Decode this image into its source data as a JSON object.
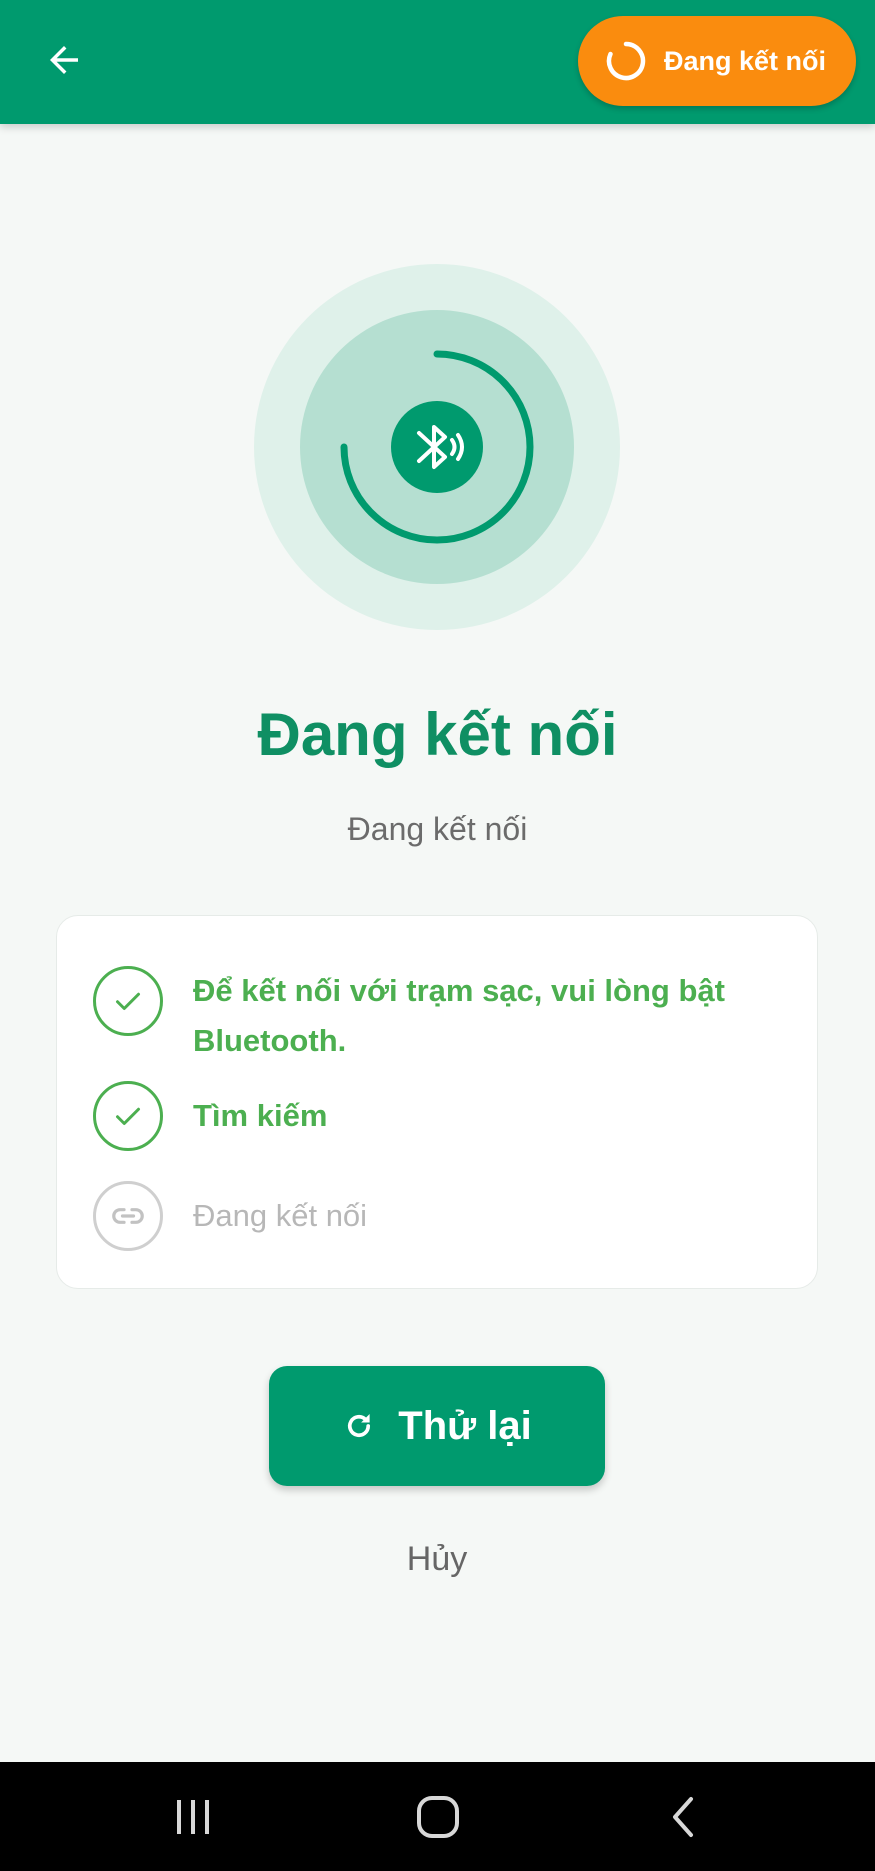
{
  "colors": {
    "primary": "#009a6e",
    "title_green": "#0f8f63",
    "success_green": "#4caf50",
    "status_orange": "#fa8c0e",
    "pending_gray": "#b7b7b7"
  },
  "header": {
    "back_icon": "arrow-left-icon",
    "status_badge": {
      "icon": "spinner-icon",
      "label": "Đang kết nối"
    }
  },
  "hero": {
    "icon": "bluetooth-searching-icon",
    "progress_fraction": 0.75
  },
  "main": {
    "title": "Đang kết nối",
    "subtitle": "Đang kết nối"
  },
  "steps": [
    {
      "label_line1": "Để kết nối với trạm sạc, vui lòng bật",
      "label_line2": "Bluetooth.",
      "state": "done",
      "icon": "check-icon"
    },
    {
      "label": "Tìm kiếm",
      "state": "done",
      "icon": "check-icon"
    },
    {
      "label": "Đang kết nối",
      "state": "pending",
      "icon": "link-icon"
    }
  ],
  "actions": {
    "retry_label": "Thử lại",
    "retry_icon": "refresh-icon",
    "cancel_label": "Hủy"
  },
  "system_nav": {
    "buttons": [
      "recent-apps-icon",
      "home-icon",
      "back-chevron-icon"
    ]
  }
}
